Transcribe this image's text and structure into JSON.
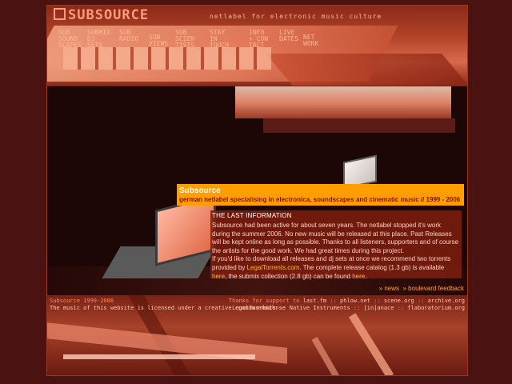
{
  "header": {
    "logo": "SUBSOURCE",
    "tagline": "netlabel for electronic music culture",
    "nav": [
      {
        "label": "SUB\nSOUND\nSCAPES"
      },
      {
        "label": "SUBMIX\nDJ\nSETS"
      },
      {
        "label": "SUB\nRADIO"
      },
      {
        "label": "SUB\nVIEWS"
      },
      {
        "label": "SUB\nSCIEN\nTISTS"
      },
      {
        "label": "STAY\nIN\nTOUCH"
      },
      {
        "label": "INFO\n+ CON\nTACT"
      },
      {
        "label": "LIVE\nDATES"
      },
      {
        "label": "NET\nWORK"
      }
    ]
  },
  "main": {
    "title": "Subsource",
    "subtitle": "german netlabel specialising in electronica, soundscapes and cinematic music // 1999 - 2006",
    "info_heading": "THE LAST INFORMATION",
    "info_p1": "Subsource had been active for about seven years. The netlabel stopped it's work during the summer 2006. No new music will be released at this place. Past Releases will be kept online as long as possible. Thanks to all listeners, supporters and of course the artists for the good work. We had great times during this project.",
    "info_p2_a": "If you'd like to download all releases and dj sets at once we recommend two torrents provided by ",
    "info_link_legaltorrents": "LegalTorrents.com",
    "info_p2_b": ". The complete release catalog (1.3 gb) is available ",
    "info_link_here1": "here",
    "info_p2_c": ", the submix collection (2.8 gb) can be found ",
    "info_link_here2": "here",
    "info_p2_d": ".",
    "link_news": "» news",
    "link_feedback": "» boulevard feedback"
  },
  "footer": {
    "copyright": "Subsource 1999-2006",
    "license": "The music of this website is licensed under a creative commons license",
    "email": "✉ email",
    "thanks_prefix": "Thanks for support to",
    "thanks_links": [
      "last.fm",
      "phlow.net",
      "scene.org",
      "archive.org"
    ],
    "partner_links": [
      "LegalTorrents",
      "Native Instruments",
      "[in]anace",
      "flaboratorium.org"
    ],
    "separator": "::"
  }
}
